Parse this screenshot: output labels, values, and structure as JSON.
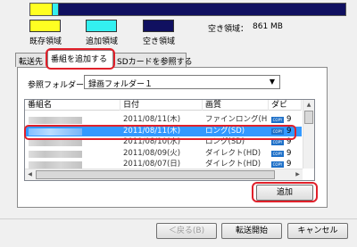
{
  "capacity": {
    "used_fraction": 0.07,
    "added_fraction": 0.02,
    "colors": {
      "used": "#ffff22",
      "added": "#33f0f0",
      "free": "#101060"
    },
    "legend": [
      {
        "label": "既存領域"
      },
      {
        "label": "追加領域"
      },
      {
        "label": "空き領域"
      }
    ],
    "free_label": "空き領域：",
    "free_value": "861 MB"
  },
  "tabs": [
    {
      "label": "転送先"
    },
    {
      "label": "番組を追加する"
    },
    {
      "label": "SDカードを参照する"
    }
  ],
  "folder": {
    "label": "参照フォルダー",
    "value": "録画フォルダー１"
  },
  "list": {
    "columns": [
      "番組名",
      "日付",
      "画質",
      "ダビ"
    ],
    "rows": [
      {
        "date": "2011/08/11(木)",
        "quality": "ファインロング(H",
        "copies": "9"
      },
      {
        "date": "2011/08/11(木)",
        "quality": "ロング(SD)",
        "copies": "9",
        "selected": true
      },
      {
        "date": "2011/08/10(水)",
        "quality": "ロング(SD)",
        "copies": "9"
      },
      {
        "date": "2011/08/09(火)",
        "quality": "ダイレクト(HD)",
        "copies": "9"
      },
      {
        "date": "2011/08/07(日)",
        "quality": "ダイレクト(HD)",
        "copies": "9"
      },
      {
        "date": "2011/08/07(日)",
        "quality": "ダイレクト(HD)",
        "copies": "9"
      },
      {
        "date": "2011/08/06(土)",
        "quality": "ダイレクト(HD)",
        "copies": "9"
      }
    ],
    "copy_badge": "COPY"
  },
  "buttons": {
    "add": "追加",
    "back": "＜戻る(B)",
    "start": "転送開始",
    "cancel": "キャンセル"
  },
  "highlight_color": "#e0202a",
  "selection_color": "#3399ff"
}
